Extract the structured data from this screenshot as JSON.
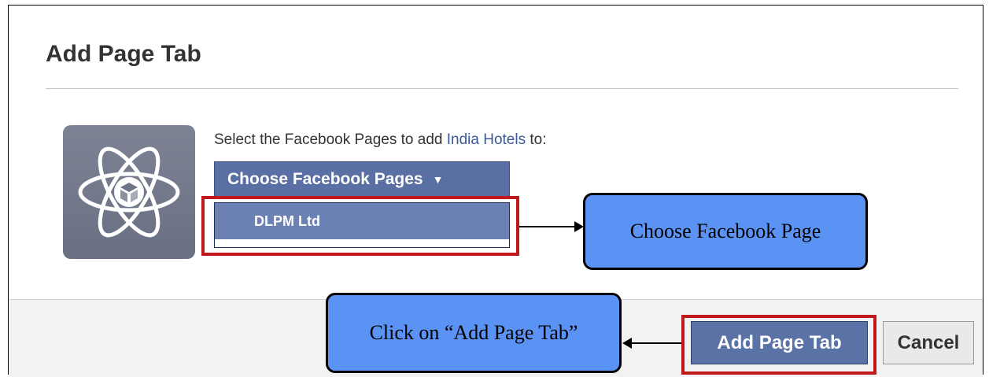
{
  "dialog": {
    "title": "Add Page Tab"
  },
  "app_icon": {
    "icon": "atom-app-icon"
  },
  "prompt": {
    "prefix": "Select the Facebook Pages to add ",
    "app_name": "India Hotels",
    "suffix": " to:"
  },
  "pages_selector": {
    "button_label": "Choose Facebook Pages",
    "options": [
      "DLPM Ltd"
    ]
  },
  "footer": {
    "add_label": "Add Page Tab",
    "cancel_label": "Cancel"
  },
  "annotations": {
    "choose_callout": "Choose Facebook Page",
    "click_callout": "Click on “Add Page Tab”",
    "highlight_color": "#c0181b",
    "callout_color": "#5b93f5"
  }
}
